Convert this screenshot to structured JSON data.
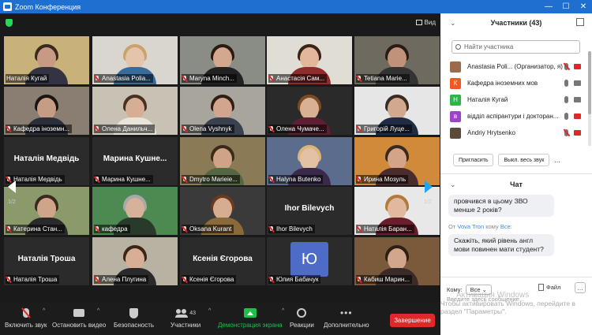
{
  "window": {
    "title": "Zoom Конференция",
    "controls": [
      "—",
      "☐",
      "✕"
    ]
  },
  "view_button": "Вид",
  "tiles": [
    {
      "name": "Наталія Кугай",
      "muted": false,
      "speaker": true,
      "video": true,
      "scene": "#c8b27a",
      "hair": "#3b2a1c",
      "skin": "#c79a84",
      "shirt": "#334"
    },
    {
      "name": "Anastasia Polia...",
      "muted": true,
      "video": true,
      "scene": "#d9d6cf",
      "hair": "#c9a36b",
      "skin": "#e4c4aa",
      "shirt": "#3a6a9a"
    },
    {
      "name": "Maryna Minch...",
      "muted": true,
      "video": true,
      "scene": "#8a8c86",
      "hair": "#2a1a12",
      "skin": "#d3a88e",
      "shirt": "#222"
    },
    {
      "name": "Анастасія Сам...",
      "muted": true,
      "video": true,
      "scene": "#e0ddd5",
      "hair": "#3a2418",
      "skin": "#e2b79c",
      "shirt": "#8d2c2c"
    },
    {
      "name": "Tetiana Marie...",
      "muted": true,
      "video": true,
      "scene": "#6f6a5f",
      "hair": "#2b1c13",
      "skin": "#c09279",
      "shirt": "#333"
    },
    {
      "name": "Кафедра іноземн...",
      "muted": true,
      "video": true,
      "scene": "#8a7e72",
      "hair": "#1c1410",
      "skin": "#c69c84",
      "shirt": "#2b2f3c"
    },
    {
      "name": "Олена Данильч...",
      "muted": true,
      "video": true,
      "scene": "#c7c2b3",
      "hair": "#4a3020",
      "skin": "#d6ae93",
      "shirt": "#e9e4da"
    },
    {
      "name": "Olena Vyshnyk",
      "muted": true,
      "video": true,
      "scene": "#a8a59d",
      "hair": "#2e1e14",
      "skin": "#d2a68e",
      "shirt": "#39414f"
    },
    {
      "name": "Олена Чумаче...",
      "muted": true,
      "video": true,
      "scene": "#2a2a2a",
      "hair": "#7a4b24",
      "skin": "#d8b195",
      "shirt": "#5c1f33"
    },
    {
      "name": "Григорій Луце...",
      "muted": true,
      "video": true,
      "scene": "#e6e6e6",
      "hair": "#3a2b20",
      "skin": "#d2a98f",
      "shirt": "#1f2c44"
    },
    {
      "name": "Наталія Медвідь",
      "muted": true,
      "video": false
    },
    {
      "name": "Марина Кушне...",
      "muted": true,
      "video": false
    },
    {
      "name": "Dmytro Marieie...",
      "muted": true,
      "video": true,
      "scene": "#8a7a56",
      "hair": "#3a2a1a",
      "skin": "#cfa386",
      "shirt": "#556644"
    },
    {
      "name": "Halyna Butenko",
      "muted": true,
      "video": true,
      "scene": "#5c6c8c",
      "hair": "#d9b77c",
      "skin": "#e3c1a4",
      "shirt": "#3a2a4a"
    },
    {
      "name": "Ирина Мозуль",
      "muted": true,
      "video": true,
      "scene": "#d08a3a",
      "hair": "#3a2a1e",
      "skin": "#d3a488",
      "shirt": "#4a2c2c"
    },
    {
      "name": "Катерина Стан...",
      "muted": true,
      "video": true,
      "scene": "#8a9a6a",
      "hair": "#3a2a1e",
      "skin": "#cfa58a",
      "shirt": "#2a2a2a"
    },
    {
      "name": "кафедра",
      "muted": true,
      "video": true,
      "scene": "#4d8a52",
      "hair": "#a8a8a8",
      "skin": "#d6b29a",
      "shirt": "#2a3a2a"
    },
    {
      "name": "Oksana Kurant",
      "muted": true,
      "video": true,
      "scene": "#3a3a3a",
      "hair": "#6b3a1e",
      "skin": "#d7ad91",
      "shirt": "#8a6a3a"
    },
    {
      "name": "Ihor Bilevych",
      "muted": true,
      "video": false
    },
    {
      "name": "Наталія Баран...",
      "muted": true,
      "video": true,
      "scene": "#e8e8e8",
      "hair": "#b27a3c",
      "skin": "#e0b99f",
      "shirt": "#6a1e2c"
    },
    {
      "name": "Наталія Троша",
      "muted": true,
      "video": false
    },
    {
      "name": "Алена Плугина",
      "muted": true,
      "video": true,
      "scene": "#b8b2a2",
      "hair": "#3a2616",
      "skin": "#d8ae94",
      "shirt": "#2a2a2a"
    },
    {
      "name": "Ксенія Єгорова",
      "muted": true,
      "video": false
    },
    {
      "name": "Юлия Бабачук",
      "muted": true,
      "video": false,
      "avatar": "Ю",
      "avatar_color": "#4e6cc7"
    },
    {
      "name": "Кабиш Марин...",
      "muted": true,
      "video": true,
      "scene": "#7a5a3a",
      "hair": "#2e1e14",
      "skin": "#d1a68c",
      "shirt": "#3a2a2a"
    }
  ],
  "pagination": {
    "left": "1/2",
    "right": "1/2"
  },
  "toolbar": {
    "audio": "Включить звук",
    "video": "Остановить видео",
    "security": "Безопасность",
    "participants": "Участники",
    "participants_count": "43",
    "share": "Демонстрация экрана",
    "reactions": "Реакции",
    "more": "Дополнительно",
    "end": "Завершение"
  },
  "participants_panel": {
    "title": "Участники (43)",
    "search_placeholder": "Найти участника",
    "items": [
      {
        "name": "Anastasia Poli... (Организатор, я)",
        "avatar": "",
        "color": "#9b6b4a",
        "mic": "muted",
        "cam": "off"
      },
      {
        "name": "Кафедра іноземних мов",
        "avatar": "К",
        "color": "#f05a22",
        "mic": "on",
        "cam": "on"
      },
      {
        "name": "Наталія Кугай",
        "avatar": "Н",
        "color": "#2fb34a",
        "mic": "on",
        "cam": "on"
      },
      {
        "name": "відділ аспірантури і докторан...",
        "avatar": "в",
        "color": "#9c44c8",
        "mic": "on",
        "cam": "off"
      },
      {
        "name": "Andriy Hrytsenko",
        "avatar": "",
        "color": "#5a4a3a",
        "mic": "muted",
        "cam": "off"
      }
    ],
    "invite": "Пригласить",
    "mute_all": "Выкл. весь звук",
    "more": "..."
  },
  "chat": {
    "title": "Чат",
    "message1": "провчився в цьому ЗВО менше 2 років?",
    "from_prefix": "От",
    "from_name": "Vova Tron",
    "to_prefix": "кому",
    "to_name": "Все:",
    "message2": "Скажіть, який рівень англ мови повинен мати студент?",
    "to_label": "Кому:",
    "to_value": "Все",
    "file": "Файл",
    "input_placeholder": "Введите здесь сообщение..."
  },
  "watermark": {
    "line1": "Активация Windows",
    "line2": "Чтобы активировать Windows, перейдите в раздел \"Параметры\"."
  }
}
